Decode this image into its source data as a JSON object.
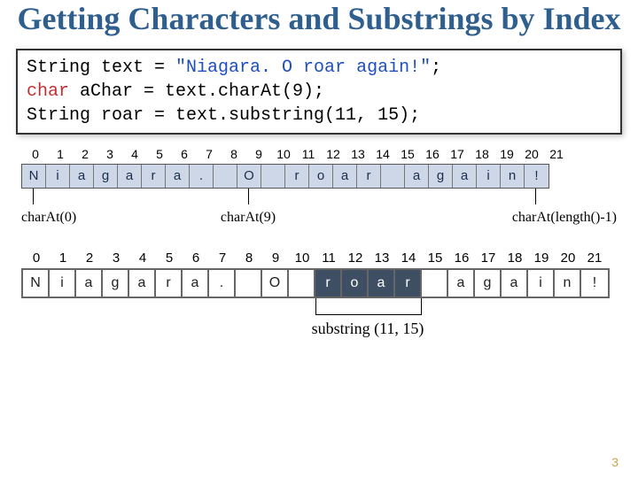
{
  "title": "Getting Characters and Substrings by Index",
  "code": {
    "line1_pre": "String text = ",
    "line1_str": "\"Niagara. O roar again!\"",
    "line1_post": ";",
    "line2_kw": "char",
    "line2_rest": " aChar = text.charAt(9);",
    "line3": "String roar = text.substring(11, 15);"
  },
  "diagram1": {
    "indices": [
      "0",
      "1",
      "2",
      "3",
      "4",
      "5",
      "6",
      "7",
      "8",
      "9",
      "10",
      "11",
      "12",
      "13",
      "14",
      "15",
      "16",
      "17",
      "18",
      "19",
      "20",
      "21"
    ],
    "chars": [
      "N",
      "i",
      "a",
      "g",
      "a",
      "r",
      "a",
      ".",
      " ",
      "O",
      " ",
      "r",
      "o",
      "a",
      "r",
      " ",
      "a",
      "g",
      "a",
      "i",
      "n",
      "!"
    ],
    "annot_left": "charAt(0)",
    "annot_mid": "charAt(9)",
    "annot_right": "charAt(length()-1)"
  },
  "diagram2": {
    "indices": [
      "0",
      "1",
      "2",
      "3",
      "4",
      "5",
      "6",
      "7",
      "8",
      "9",
      "10",
      "11",
      "12",
      "13",
      "14",
      "15",
      "16",
      "17",
      "18",
      "19",
      "20",
      "21"
    ],
    "chars": [
      "N",
      "i",
      "a",
      "g",
      "a",
      "r",
      "a",
      ".",
      " ",
      "O",
      " ",
      "r",
      "o",
      "a",
      "r",
      " ",
      "a",
      "g",
      "a",
      "i",
      "n",
      "!"
    ],
    "highlight": [
      11,
      12,
      13,
      14
    ],
    "annot": "substring (11, 15)"
  },
  "page_number": "3"
}
